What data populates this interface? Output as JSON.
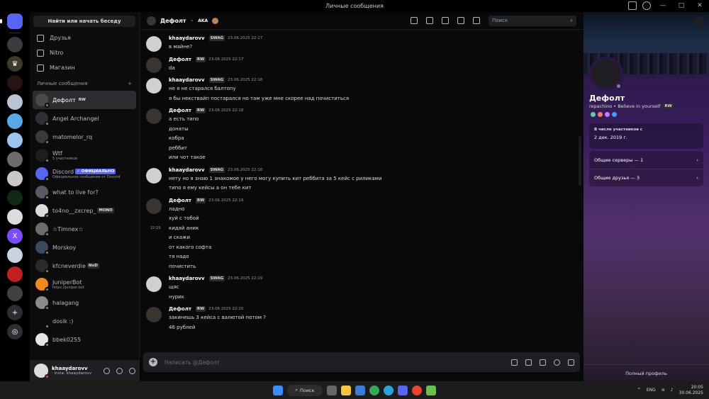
{
  "window": {
    "title": "Личные сообщения"
  },
  "servers": [
    {
      "color": "#5865f2",
      "label": "",
      "home": true
    },
    {
      "color": "#3a3a40",
      "label": ""
    },
    {
      "color": "#3c3a2a",
      "label": "♛"
    },
    {
      "color": "#2a1212",
      "label": ""
    },
    {
      "color": "#b9c3d6",
      "label": ""
    },
    {
      "color": "#5aa7e8",
      "label": ""
    },
    {
      "color": "#9fc4f0",
      "label": ""
    },
    {
      "color": "#6b6b6b",
      "label": ""
    },
    {
      "color": "#c8c8c8",
      "label": ""
    },
    {
      "color": "#0e2a14",
      "label": ""
    },
    {
      "color": "#dcdcdc",
      "label": ""
    },
    {
      "color": "#7c4dff",
      "label": "X"
    },
    {
      "color": "#c9d3e0",
      "label": ""
    },
    {
      "color": "#c02020",
      "label": ""
    },
    {
      "color": "#404040",
      "label": ""
    }
  ],
  "dm_panel": {
    "search_label": "Найти или начать беседу",
    "nav": [
      {
        "label": "Друзья",
        "icon": "friends-icon"
      },
      {
        "label": "Nitro",
        "icon": "nitro-icon"
      },
      {
        "label": "Магазин",
        "icon": "shop-icon"
      }
    ],
    "header": "Личные сообщения",
    "add": "+",
    "items": [
      {
        "name": "Дефолт",
        "tag": "RW",
        "sub": "",
        "color": "#4a4a4a",
        "active": true
      },
      {
        "name": "Angel Archangel",
        "tag": "",
        "sub": "",
        "color": "#2f2f36"
      },
      {
        "name": "matomelor_rq",
        "tag": "",
        "sub": "",
        "color": "#3a3a3a"
      },
      {
        "name": "Wtf",
        "tag": "",
        "sub": "5 участников",
        "color": "#1e1e1e"
      },
      {
        "name": "Discord",
        "tag": "✓ ОФИЦИАЛЬНО",
        "sub": "Официальное сообщение от Discord",
        "color": "#5865f2"
      },
      {
        "name": "what to live for?",
        "tag": "",
        "sub": "",
        "color": "#5a5a66"
      },
      {
        "name": "to4no__zxcrep_",
        "tag": "MONO",
        "sub": "",
        "color": "#dcdcdc"
      },
      {
        "name": "☆Timnex☆",
        "tag": "",
        "sub": "",
        "color": "#6c6c6c"
      },
      {
        "name": "Morskoy",
        "tag": "",
        "sub": "",
        "color": "#3a4a5a"
      },
      {
        "name": "kfcneverdie",
        "tag": "NoD",
        "sub": "",
        "color": "#2b2b2b"
      },
      {
        "name": "JuniperBot",
        "tag": "",
        "sub": "https://juniper.bot",
        "color": "#f08a1c"
      },
      {
        "name": "halagang",
        "tag": "",
        "sub": "",
        "color": "#8a8a8a"
      },
      {
        "name": "dosik :)",
        "tag": "",
        "sub": "",
        "color": "#0c0c0e"
      },
      {
        "name": "bbek0255",
        "tag": "",
        "sub": "",
        "color": "#e6e6e6"
      }
    ],
    "user": {
      "name": "khaaydarovv",
      "status": "· insta: khaaydarovv"
    }
  },
  "chat": {
    "title": "Дефолт",
    "aka": "AKA",
    "search_placeholder": "Поиск",
    "compose_placeholder": "Написать @Дефолт",
    "messages": [
      {
        "author": "khaaydarovv",
        "tag": "SWAG",
        "time": "23.06.2025 22:17",
        "lines": [
          "в майне?"
        ],
        "avatar": "#d0d0d0"
      },
      {
        "author": "Дефолт",
        "tag": "RW",
        "time": "23.06.2025 22:17",
        "lines": [
          "da"
        ],
        "avatar": "#3a3530"
      },
      {
        "author": "khaaydarovv",
        "tag": "SWAG",
        "time": "23.06.2025 22:18",
        "lines": [
          "не я не старался балтопу",
          "я бы некствайп постарался но там уже мне скорее над почиститься"
        ],
        "avatar": "#d0d0d0"
      },
      {
        "author": "Дефолт",
        "tag": "RW",
        "time": "23.06.2025 22:18",
        "lines": [
          "а есть типо",
          "донаты",
          "кобра",
          "реббит",
          "или чот такое"
        ],
        "avatar": "#3a3530"
      },
      {
        "author": "khaaydarovv",
        "tag": "SWAG",
        "time": "23.06.2025 22:18",
        "lines": [
          "нету но я знаю 1 знакомое у него могу купить кит реббита за 5 кейс с риликами",
          "типо я ему кейсы а он тебе кит"
        ],
        "avatar": "#d0d0d0"
      },
      {
        "author": "Дефолт",
        "tag": "RW",
        "time": "23.06.2025 22:19",
        "lines": [
          "ладно",
          "хуй с тобой",
          "кидай аник",
          "и скажи",
          "от какого софта",
          "тя надо",
          "почистить"
        ],
        "avatar": "#3a3530",
        "hover_time": "22:19"
      },
      {
        "author": "khaaydarovv",
        "tag": "SWAG",
        "time": "23.06.2025 22:19",
        "lines": [
          "щяс",
          "нурик"
        ],
        "avatar": "#d0d0d0"
      },
      {
        "author": "Дефолт",
        "tag": "RW",
        "time": "23.06.2025 22:20",
        "lines": [
          "закинешь 3 кейса с валютой потом ?",
          "46 рублей"
        ],
        "avatar": "#3a3530"
      }
    ]
  },
  "profile": {
    "name": "Дефолт",
    "user_line": "repachino • Believe in yourself",
    "tag": "RW",
    "member_label": "В числе участников с",
    "member_since": "2 дек. 2019 г.",
    "servers_label": "Общие серверы — 1",
    "friends_label": "Общие друзья — 3",
    "full_profile": "Полный профиль",
    "badge_colors": [
      "#5ad1a0",
      "#f47b67",
      "#c77dff",
      "#3ba0ff"
    ]
  },
  "taskbar": {
    "search": "Поиск",
    "lang": "ENG",
    "time": "20:05",
    "date": "30.06.2025"
  }
}
